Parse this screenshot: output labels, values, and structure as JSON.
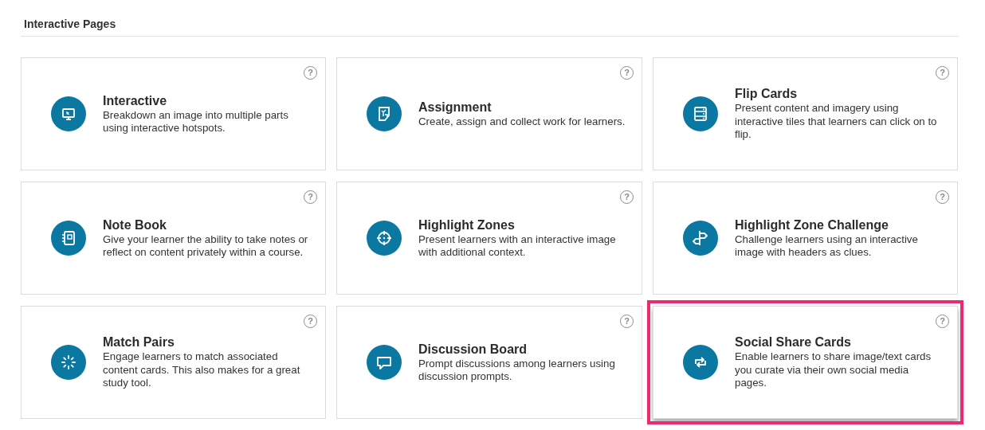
{
  "section": {
    "title": "Interactive Pages"
  },
  "cards": [
    {
      "kind": "monitor",
      "title": "Interactive",
      "description": "Breakdown an image into multiple parts using interactive hotspots.",
      "help": "?",
      "highlighted": false
    },
    {
      "kind": "assignment",
      "title": "Assignment",
      "description": "Create, assign and collect work for learners.",
      "help": "?",
      "highlighted": false
    },
    {
      "kind": "list",
      "title": "Flip Cards",
      "description": "Present content and imagery using interactive tiles that learners can click on to flip.",
      "help": "?",
      "highlighted": false
    },
    {
      "kind": "notebook",
      "title": "Note Book",
      "description": "Give your learner the ability to take notes or reflect on content privately within a course.",
      "help": "?",
      "highlighted": false
    },
    {
      "kind": "target",
      "title": "Highlight Zones",
      "description": "Present learners with an interactive image with additional context.",
      "help": "?",
      "highlighted": false
    },
    {
      "kind": "signpost",
      "title": "Highlight Zone Challenge",
      "description": "Challenge learners using an interactive image with headers as clues.",
      "help": "?",
      "highlighted": false
    },
    {
      "kind": "spinner",
      "title": "Match Pairs",
      "description": "Engage learners to match associated content cards. This also makes for a great study tool.",
      "help": "?",
      "highlighted": false
    },
    {
      "kind": "chat",
      "title": "Discussion Board",
      "description": "Prompt discussions among learners using discussion prompts.",
      "help": "?",
      "highlighted": false
    },
    {
      "kind": "repeat",
      "title": "Social Share Cards",
      "description": "Enable learners to share image/text cards you curate via their own social media pages.",
      "help": "?",
      "highlighted": true
    }
  ]
}
